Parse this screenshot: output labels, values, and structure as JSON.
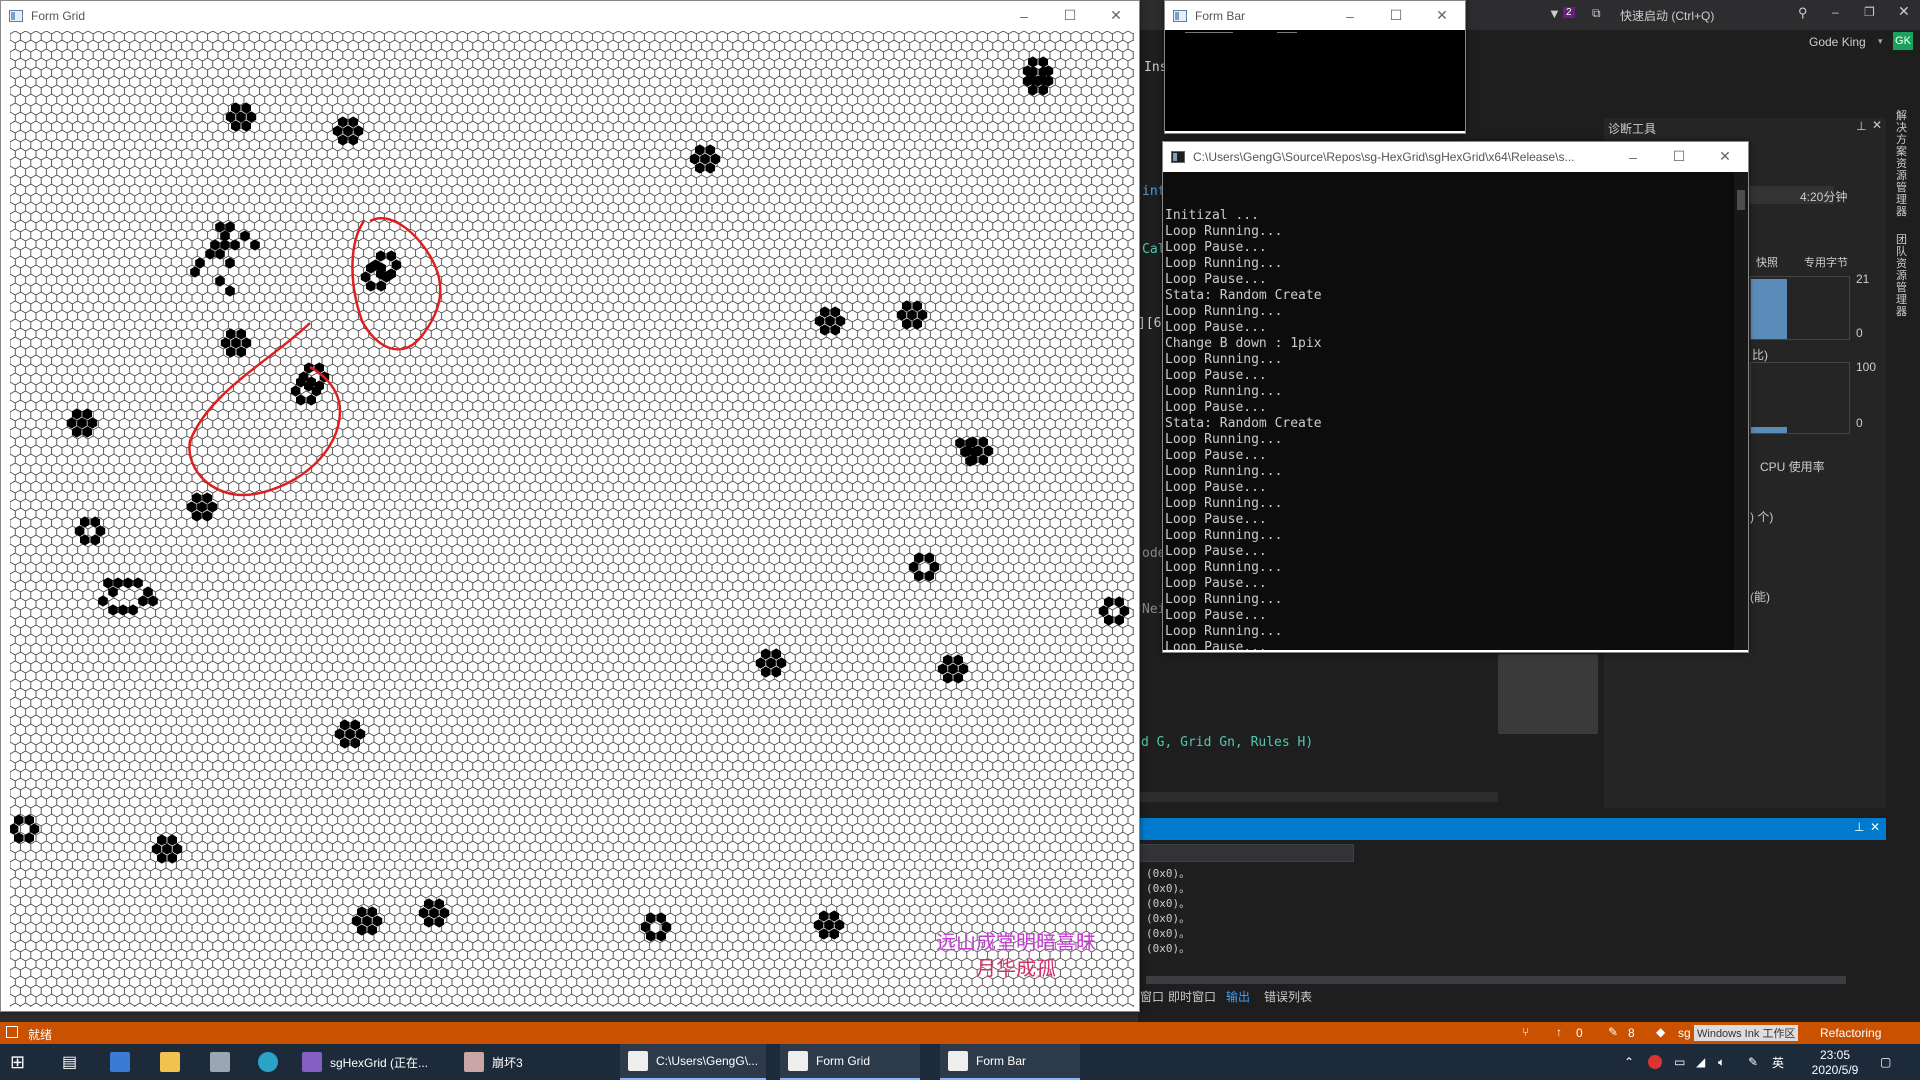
{
  "form_grid": {
    "title": "Form Grid",
    "watermark_line1": "远山成堂明暗喜昧",
    "watermark_line2": "月华成孤"
  },
  "form_bar": {
    "title": "Form Bar"
  },
  "console": {
    "title": "C:\\Users\\GengG\\Source\\Repos\\sg-HexGrid\\sgHexGrid\\x64\\Release\\s...",
    "lines": [
      "Initizal ...",
      "Loop Running...",
      "Loop Pause...",
      "Loop Running...",
      "Loop Pause...",
      "Stata: Random Create",
      "Loop Running...",
      "Loop Pause...",
      "Change B down : 1pix",
      "Loop Running...",
      "Loop Pause...",
      "Loop Running...",
      "Loop Pause...",
      "Stata: Random Create",
      "Loop Running...",
      "Loop Pause...",
      "Loop Running...",
      "Loop Pause...",
      "Loop Running...",
      "Loop Pause...",
      "Loop Running...",
      "Loop Pause...",
      "Loop Running...",
      "Loop Pause...",
      "Loop Running...",
      "Loop Pause...",
      "Loop Running...",
      "Loop Pause..."
    ]
  },
  "vs": {
    "quick_launch": "快速启动 (Ctrl+Q)",
    "user": "Gode King",
    "user_initials": "GK",
    "filter_count": "2",
    "diag_tools": "诊断工具",
    "time": "4:20分钟",
    "snapshot": "快照",
    "private_bytes": "专用字节",
    "mem_max": "21",
    "mem_min": "0",
    "pct_label": "比)",
    "cpu_max": "100",
    "cpu_min": "0",
    "cpu_usage": "CPU 使用率",
    "count_label": ") 个)",
    "perf_label": "(能)",
    "code_int": "int",
    "code_cal": "Cal",
    "code_bracket": "][6",
    "code_ode": "ode",
    "code_nei": "Nei",
    "code_insi": "Insi",
    "code_sig": "d G, Grid Gn, Rules H)",
    "output_lines": [
      "(0x0)。",
      "(0x0)。",
      "(0x0)。",
      "(0x0)。",
      "(0x0)。",
      "(0x0)。"
    ],
    "tab_window": "窗口",
    "tab_immediate": "即时窗口",
    "tab_output": "输出",
    "tab_errors": "错误列表",
    "side_text1": "解决方案资源管理器",
    "side_text2": "团队资源管理器"
  },
  "status": {
    "ready": "就绪",
    "up_count": "0",
    "edit_count": "8",
    "repo": "sg",
    "ink": "Windows Ink 工作区",
    "refactoring": "Refactoring"
  },
  "taskbar": {
    "items": [
      "sgHexGrid (正在...",
      "崩坏3",
      "C:\\Users\\GengG\\...",
      "Form Grid",
      "Form Bar"
    ],
    "ime": "英",
    "clock_time": "23:05",
    "clock_date": "2020/5/9"
  },
  "colors": {
    "status_orange": "#ca5100",
    "vs_blue": "#007acc",
    "annotation_red": "#e02020",
    "watermark_purple": "#c23cd0"
  }
}
